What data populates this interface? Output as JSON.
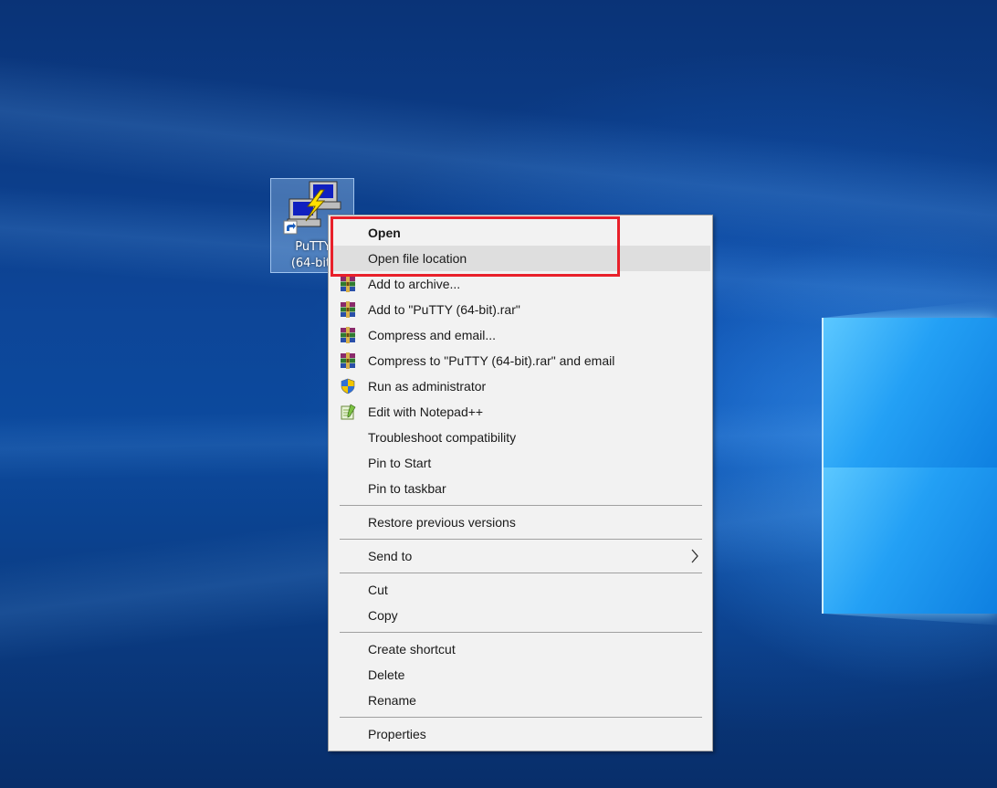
{
  "desktop": {
    "icon": {
      "label_line1": "PuTTY",
      "label_line2": "(64-bit)",
      "icon_name": "putty-icon"
    }
  },
  "context_menu": {
    "items": [
      {
        "label": "Open",
        "bold": true
      },
      {
        "label": "Open file location",
        "hovered": true
      },
      {
        "label": "Add to archive...",
        "icon": "winrar-icon"
      },
      {
        "label": "Add to \"PuTTY (64-bit).rar\"",
        "icon": "winrar-icon"
      },
      {
        "label": "Compress and email...",
        "icon": "winrar-icon"
      },
      {
        "label": "Compress to \"PuTTY (64-bit).rar\" and email",
        "icon": "winrar-icon"
      },
      {
        "label": "Run as administrator",
        "icon": "uac-shield-icon"
      },
      {
        "label": "Edit with Notepad++",
        "icon": "notepad-plus-plus-icon"
      },
      {
        "label": "Troubleshoot compatibility"
      },
      {
        "label": "Pin to Start"
      },
      {
        "label": "Pin to taskbar"
      },
      {
        "label": "Restore previous versions"
      },
      {
        "label": "Send to",
        "icon": "chevron-right-icon"
      },
      {
        "label": "Cut"
      },
      {
        "label": "Copy"
      },
      {
        "label": "Create shortcut"
      },
      {
        "label": "Delete"
      },
      {
        "label": "Rename"
      },
      {
        "label": "Properties"
      }
    ]
  },
  "colors": {
    "highlight_border": "#e8202a",
    "menu_background": "#f2f2f2",
    "menu_hover": "#dedede"
  }
}
